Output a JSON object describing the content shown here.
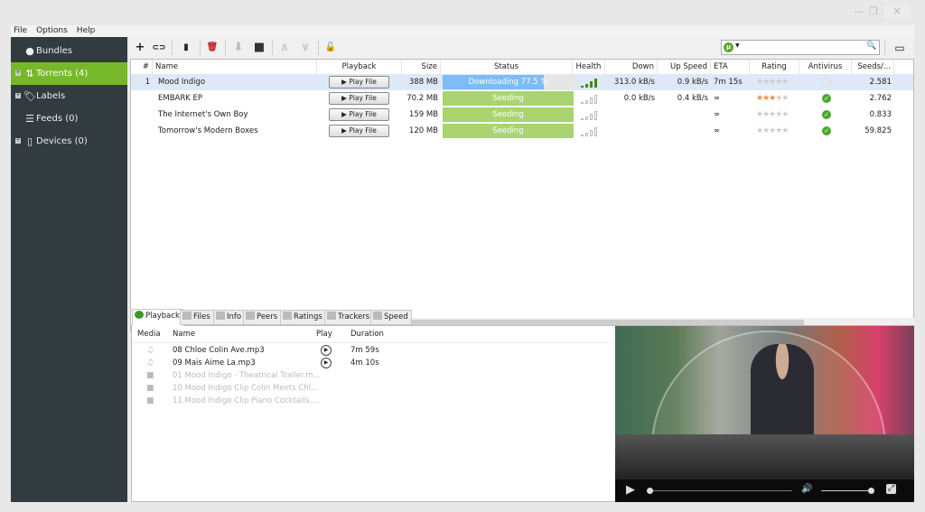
{
  "window": {
    "minimize": "—",
    "restore": "❐",
    "close": "✕"
  },
  "menu": [
    "File",
    "Options",
    "Help"
  ],
  "sidebar": [
    {
      "label": "Bundles",
      "icon": "bundle-icon",
      "expandable": false,
      "active": false
    },
    {
      "label": "Torrents (4)",
      "icon": "torrents-arrows-icon",
      "expandable": true,
      "active": true
    },
    {
      "label": "Labels",
      "icon": "tag-icon",
      "expandable": true,
      "active": false
    },
    {
      "label": "Feeds (0)",
      "icon": "rss-icon",
      "expandable": false,
      "active": false
    },
    {
      "label": "Devices (0)",
      "icon": "device-icon",
      "expandable": true,
      "active": false
    }
  ],
  "toolbar": {
    "add": "+",
    "link": "⊂⊃",
    "create": "▮",
    "remove": "🗑",
    "download": "⬇",
    "stop": "■",
    "up": "∧",
    "down": "∨",
    "unlock": "🔓",
    "search_placeholder": "",
    "search_icon": "🔍",
    "remote": "▭"
  },
  "table": {
    "columns": [
      "#",
      "Name",
      "Playback",
      "Size",
      "Status",
      "Health",
      "Down Speed",
      "Up Speed",
      "ETA",
      "Rating",
      "Antivirus",
      "Seeds/..."
    ],
    "rows": [
      {
        "num": "1",
        "name": "Mood Indigo",
        "play": "▶ Play File",
        "size": "388 MB",
        "status": "Downloading 77.5 %",
        "progress": 77.5,
        "health": "full",
        "down": "313.0 kB/s",
        "up": "0.9 kB/s",
        "eta": "7m 15s",
        "rating": 0,
        "antivirus": "pending",
        "seeds": "2.581"
      },
      {
        "num": "",
        "name": "EMBARK EP",
        "play": "▶ Play File",
        "size": "70.2 MB",
        "status": "Seeding",
        "progress": 100,
        "health": "empty",
        "down": "0.0 kB/s",
        "up": "0.4 kB/s",
        "eta": "∞",
        "rating": 3,
        "antivirus": "ok",
        "seeds": "2.762"
      },
      {
        "num": "",
        "name": "The Internet's Own Boy",
        "play": "▶ Play File",
        "size": "159 MB",
        "status": "Seeding",
        "progress": 100,
        "health": "empty",
        "down": "",
        "up": "",
        "eta": "∞",
        "rating": 0,
        "antivirus": "ok",
        "seeds": "0.833"
      },
      {
        "num": "",
        "name": "Tomorrow's Modern Boxes",
        "play": "▶ Play File",
        "size": "120 MB",
        "status": "Seeding",
        "progress": 100,
        "health": "empty",
        "down": "",
        "up": "",
        "eta": "∞",
        "rating": 0,
        "antivirus": "ok",
        "seeds": "59.825"
      }
    ]
  },
  "tabs": [
    "Playback",
    "Files",
    "Info",
    "Peers",
    "Ratings",
    "Trackers",
    "Speed"
  ],
  "files": {
    "columns": [
      "Media",
      "Name",
      "Play",
      "Duration"
    ],
    "rows": [
      {
        "type": "audio",
        "name": "08 Chloe Colin Ave.mp3",
        "duration": "7m 59s",
        "playable": true
      },
      {
        "type": "audio",
        "name": "09 Mais Aime La.mp3",
        "duration": "4m 10s",
        "playable": true
      },
      {
        "type": "video",
        "name": "01 Mood Indigo - Theatrical Trailer.m...",
        "duration": "",
        "playable": false
      },
      {
        "type": "video",
        "name": "10 Mood Indigo Clip Colin Meets Chl...",
        "duration": "",
        "playable": false
      },
      {
        "type": "video",
        "name": "11 Mood Indigo Clip Piano Cocktails....",
        "duration": "",
        "playable": false
      }
    ]
  },
  "player": {
    "position": 0,
    "volume": 100,
    "play": "▶",
    "volume_icon": "🔊",
    "fullscreen": "⤢"
  },
  "colors": {
    "accent": "#76b82a",
    "sidebar": "#313b40",
    "progress": "#7dbcf6",
    "seeding": "#a9d46f"
  }
}
